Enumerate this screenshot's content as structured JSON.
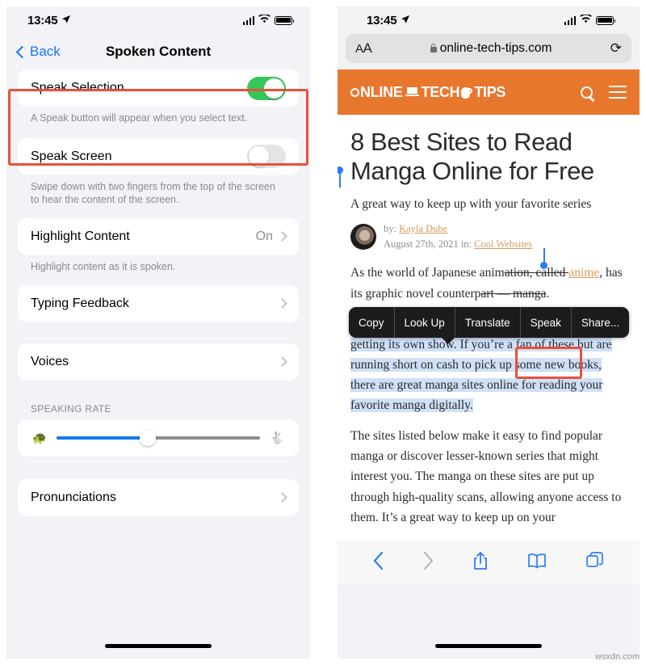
{
  "left_phone": {
    "status_bar": {
      "time": "13:45",
      "location_icon": "location-arrow-icon",
      "signal_icon": "cellular-signal-icon",
      "wifi_icon": "wifi-icon",
      "battery_icon": "battery-full-icon"
    },
    "nav": {
      "back_label": "Back",
      "title": "Spoken Content",
      "back_icon": "chevron-left-icon"
    },
    "rows": [
      {
        "label": "Speak Selection",
        "control": "toggle",
        "value": "on",
        "footnote": "A Speak button will appear when you select text."
      },
      {
        "label": "Speak Screen",
        "control": "toggle",
        "value": "off",
        "footnote": "Swipe down with two fingers from the top of the screen to hear the content of the screen."
      },
      {
        "label": "Highlight Content",
        "control": "disclosure",
        "value": "On",
        "footnote": "Highlight content as it is spoken."
      },
      {
        "label": "Typing Feedback",
        "control": "disclosure",
        "value": "",
        "footnote": ""
      },
      {
        "label": "Voices",
        "control": "disclosure",
        "value": "",
        "footnote": ""
      }
    ],
    "speaking_rate": {
      "header": "SPEAKING RATE",
      "slow_icon": "tortoise-icon",
      "fast_icon": "hare-icon",
      "slow_glyph": "🐢",
      "fast_glyph": "🐇",
      "value_percent": 45,
      "fill_color": "#1479ea",
      "track_color": "#8e8e93"
    },
    "pronunciations": {
      "label": "Pronunciations"
    },
    "annotation": {
      "color": "#e8503a",
      "target": "Speak Selection"
    }
  },
  "right_phone": {
    "status_bar": {
      "time": "13:45",
      "location_icon": "location-arrow-icon",
      "signal_icon": "cellular-signal-icon",
      "wifi_icon": "wifi-icon",
      "battery_icon": "battery-full-icon"
    },
    "urlbar": {
      "text_size_label": "A",
      "text_size_label_big": "A",
      "lock_icon": "lock-icon",
      "url": "online-tech-tips.com",
      "reload_icon": "reload-icon",
      "reload_glyph": "⟳"
    },
    "site_header": {
      "background": "#e8772e",
      "logo_parts": {
        "online": "NLINE",
        "tech": "TECH",
        "tips": "TIPS"
      },
      "laptop_icon": "laptop-icon",
      "mouse_icon": "mouse-icon",
      "search_icon": "search-icon",
      "menu_icon": "hamburger-menu-icon"
    },
    "article": {
      "title": "8 Best Sites to Read Manga Online for Free",
      "subtitle": "A great way to keep up with your favorite series",
      "byline_prefix": "by:",
      "author": "Kayla Dube",
      "date": "August 27th, 2021 in:",
      "category": "Cool Websites",
      "avatar_icon": "author-avatar",
      "paragraph1_a": "As the world of Japanese anim",
      "paragraph1_b": "ation, called ",
      "paragraph1_link": "anime",
      "paragraph1_c": ",",
      "paragraph1_d": "has its graphic novel counterp",
      "paragraph1_e": "art — manga",
      "paragraph1_f": ".",
      "paragraph2_selected": "Almost every anime usually starts as a manga before getting its own show. If you’re a fan of these but are running short on cash to pick up some new books, there are great manga sites online for reading your favorite manga digitally.",
      "paragraph3": "The sites listed below make it easy to find popular manga or discover lesser-known series that might interest you. The manga on these sites are put up through high-quality scans, allowing anyone access to them. It’s a great way to keep up on your",
      "selection_color": "#cfe0f7",
      "link_color": "#d79a5b"
    },
    "selection_toolbar": {
      "items": [
        "Copy",
        "Look Up",
        "Translate",
        "Speak",
        "Share..."
      ],
      "background": "#1c1c1e"
    },
    "bottom_bar": {
      "back_icon": "chevron-left-icon",
      "back_glyph": "‹",
      "forward_icon": "chevron-right-icon",
      "forward_glyph": "›",
      "share_icon": "share-icon",
      "bookmarks_icon": "book-icon",
      "tabs_icon": "tabs-icon"
    },
    "annotation": {
      "color": "#e8503a",
      "target": "Speak"
    }
  },
  "watermark": {
    "text": "wsxdn.com"
  }
}
